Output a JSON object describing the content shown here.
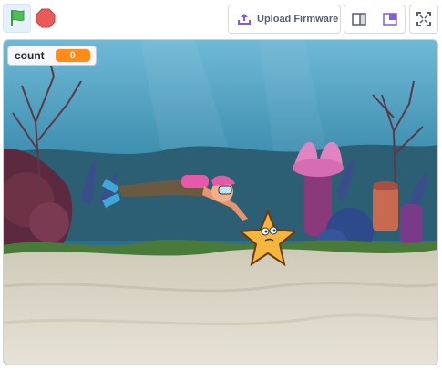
{
  "toolbar": {
    "green_flag_icon": "green-flag-icon",
    "stop_icon": "stop-sign-icon",
    "upload_label": "Upload Firmware",
    "upload_icon": "upload-icon",
    "small_stage_icon": "small-stage-layout-icon",
    "normal_stage_icon": "normal-stage-layout-icon",
    "fullscreen_icon": "fullscreen-icon",
    "colors": {
      "flag": "#4cbf56",
      "stop": "#ec5959",
      "accent": "#855cd6"
    }
  },
  "stage": {
    "backdrop": "underwater-scene",
    "sprites": [
      "diver",
      "starfish"
    ],
    "monitor": {
      "label": "count",
      "value": "0",
      "color": "#ff8c1a"
    }
  }
}
